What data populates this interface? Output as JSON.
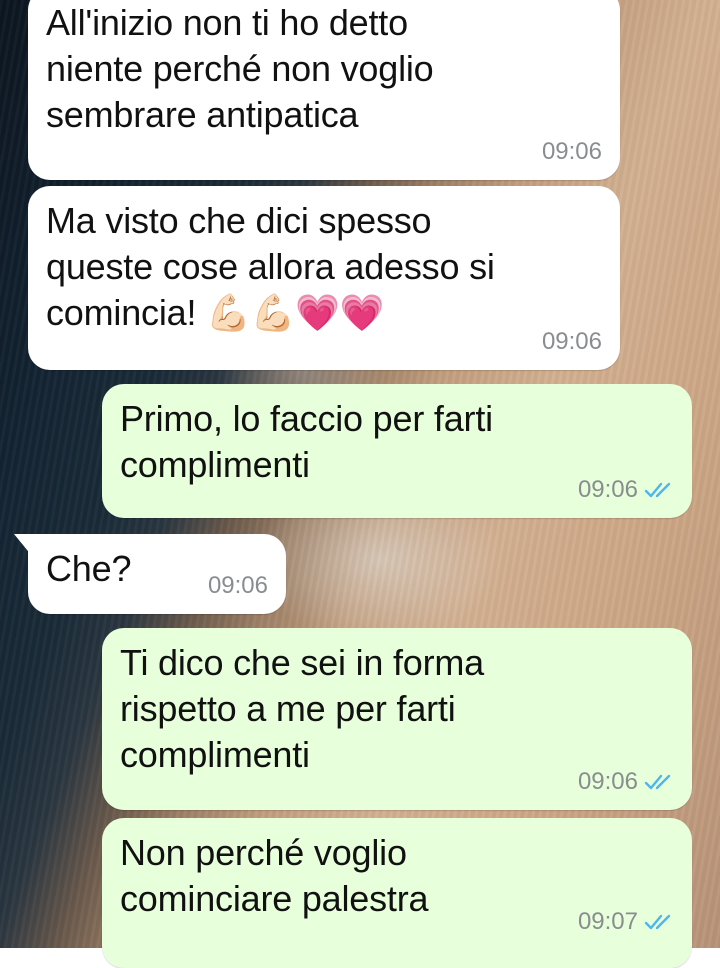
{
  "messages": [
    {
      "direction": "in",
      "text": "All'inizio non ti ho detto\nniente perché non voglio\nsembrare antipatica",
      "time": "09:06"
    },
    {
      "direction": "in",
      "text": "Ma visto che dici spesso\nqueste cose allora adesso si\ncomincia! 💪🏻💪🏻💗💗",
      "time": "09:06"
    },
    {
      "direction": "out",
      "text": "Primo, lo faccio per farti\ncomplimenti",
      "time": "09:06",
      "status": "read"
    },
    {
      "direction": "in",
      "text": "Che?",
      "time": "09:06"
    },
    {
      "direction": "out",
      "text": "Ti dico che sei in forma\nrispetto a me per farti\ncomplimenti",
      "time": "09:06",
      "status": "read"
    },
    {
      "direction": "out",
      "text": "Non perché voglio\ncominciare palestra",
      "time": "09:07",
      "status": "read"
    }
  ],
  "colors": {
    "incoming_bubble": "#ffffff",
    "outgoing_bubble": "#e7ffdb",
    "read_ticks": "#4fb6ec",
    "timestamp": "#8a8d8f"
  },
  "icons": {
    "read_receipt": "double-check-icon"
  }
}
